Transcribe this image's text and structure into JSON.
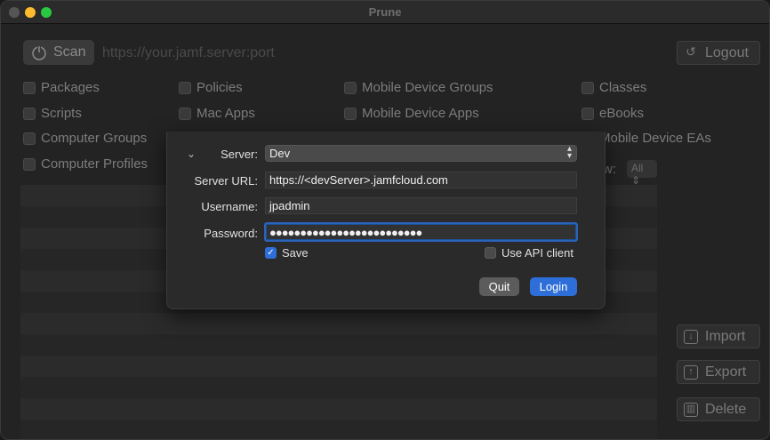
{
  "window": {
    "title": "Prune"
  },
  "toolbar": {
    "scan_label": "Scan",
    "url_placeholder": "https://your.jamf.server:port",
    "logout_label": "Logout"
  },
  "categories": {
    "col1": [
      "Packages",
      "Scripts",
      "Computer Groups",
      "Computer Profiles"
    ],
    "col2": [
      "Policies",
      "Mac Apps"
    ],
    "col3": [
      "Mobile Device Groups",
      "Mobile Device Apps"
    ],
    "col4": [
      "Classes",
      "eBooks",
      "Mobile Device EAs"
    ]
  },
  "view": {
    "show_label": "w:",
    "show_value": "All"
  },
  "actions": {
    "import_label": "Import",
    "export_label": "Export",
    "delete_label": "Delete"
  },
  "login_sheet": {
    "server_label": "Server:",
    "server_value": "Dev",
    "server_url_label": "Server URL:",
    "server_url_value": "https://<devServer>.jamfcloud.com",
    "username_label": "Username:",
    "username_value": "jpadmin",
    "password_label": "Password:",
    "password_value": "●●●●●●●●●●●●●●●●●●●●●●●●●",
    "save_label": "Save",
    "save_checked": true,
    "api_client_label": "Use API client",
    "api_client_checked": false,
    "quit_label": "Quit",
    "login_label": "Login"
  },
  "colors": {
    "accent": "#2e6ed8",
    "focus_ring": "#2a63b9"
  }
}
